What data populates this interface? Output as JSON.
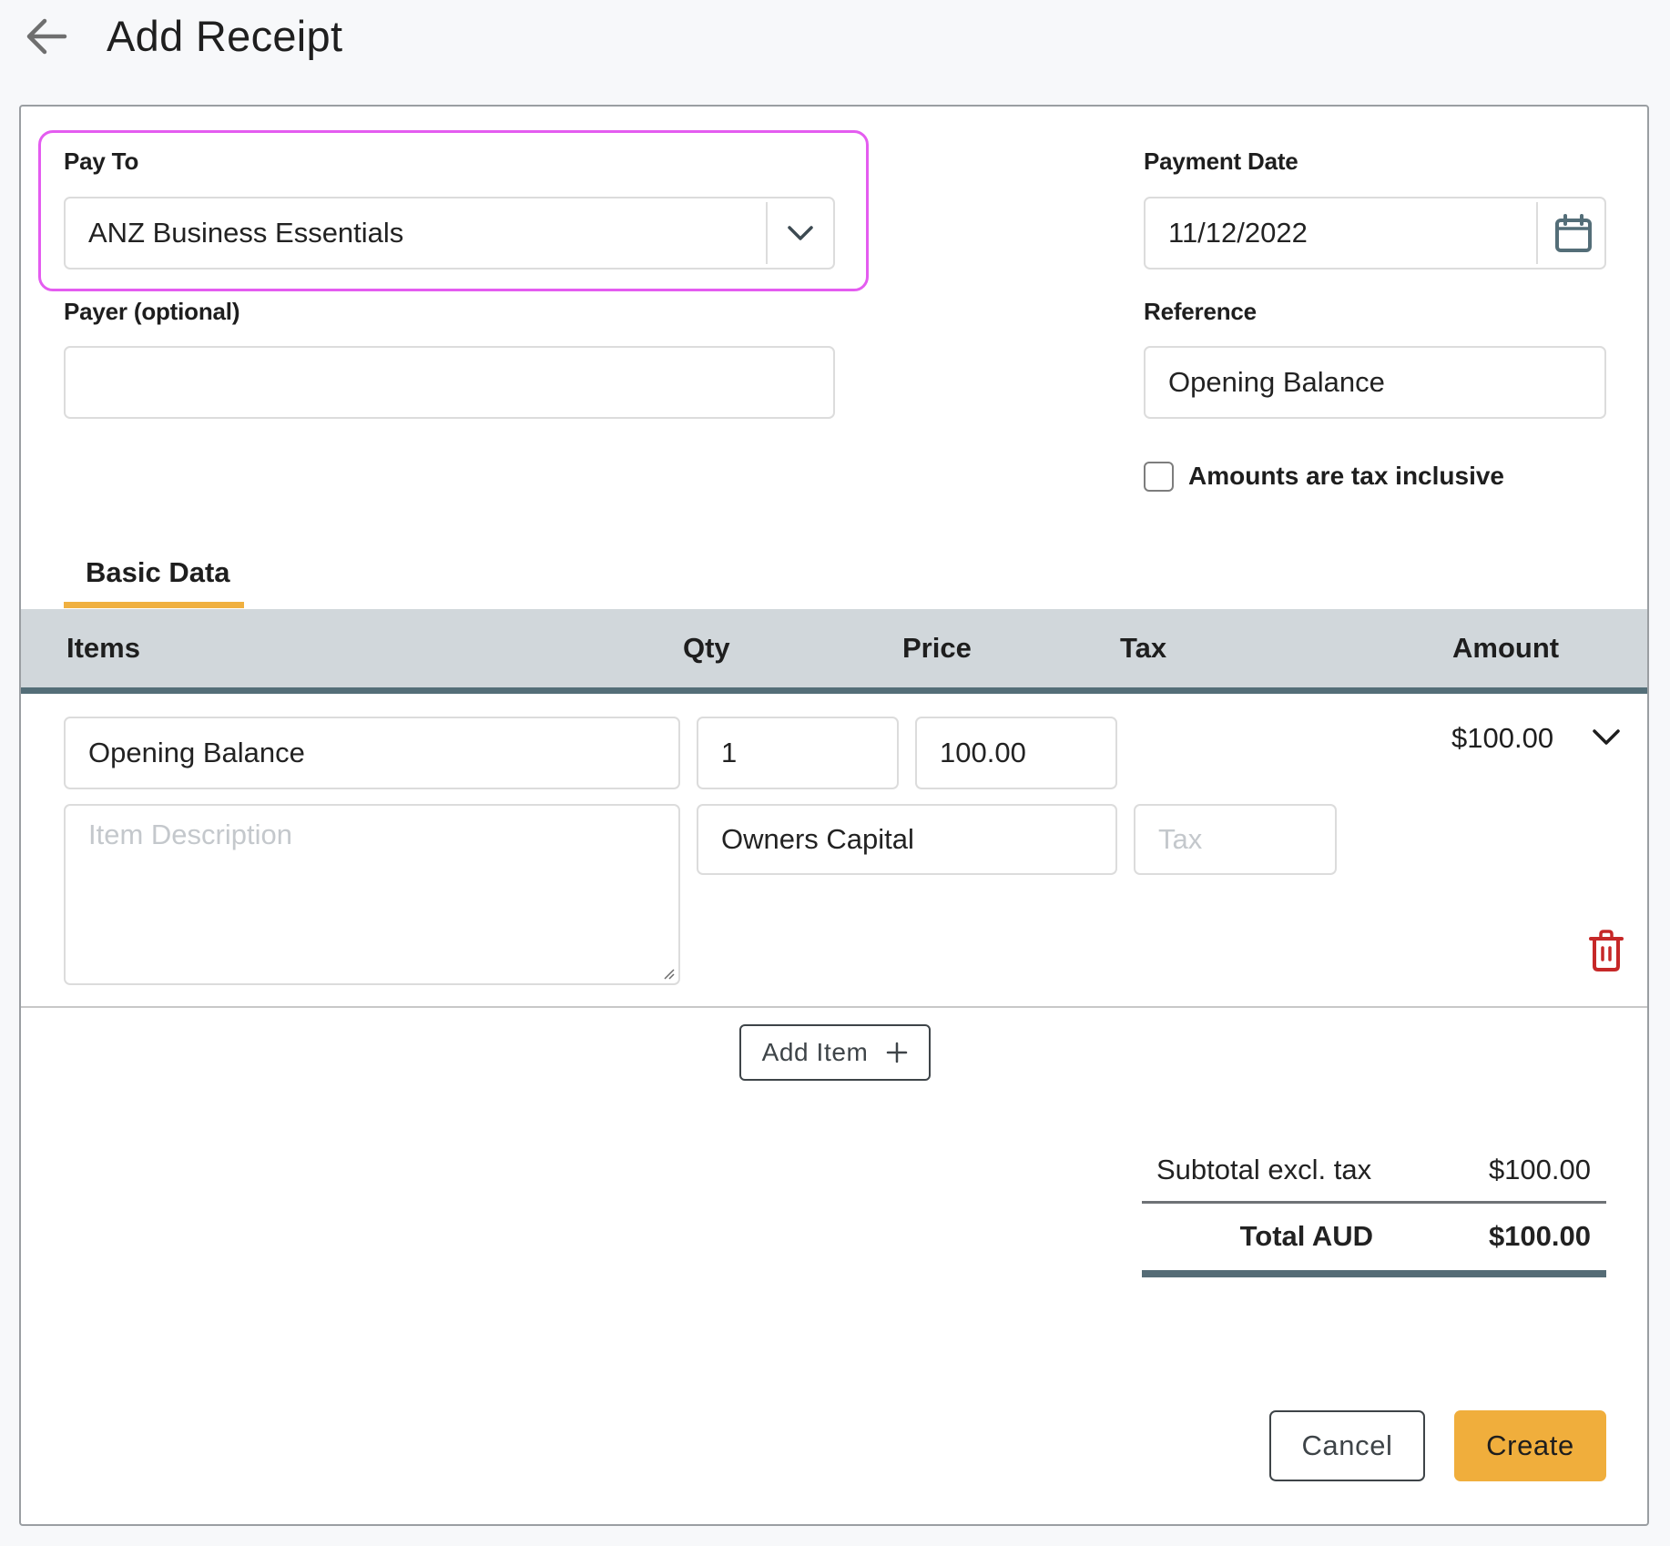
{
  "header": {
    "title": "Add Receipt",
    "back_icon": "arrow-left-icon"
  },
  "form": {
    "pay_to": {
      "label": "Pay To",
      "value": "ANZ Business Essentials",
      "icon": "chevron-down-icon"
    },
    "payer": {
      "label": "Payer (optional)",
      "value": ""
    },
    "payment_date": {
      "label": "Payment Date",
      "value": "11/12/2022",
      "icon": "calendar-icon"
    },
    "reference": {
      "label": "Reference",
      "value": "Opening Balance"
    },
    "tax_inclusive": {
      "label": "Amounts are tax inclusive",
      "checked": false
    }
  },
  "tabs": [
    {
      "label": "Basic Data",
      "active": true
    }
  ],
  "table": {
    "columns": [
      "Items",
      "Qty",
      "Price",
      "Tax",
      "Amount"
    ],
    "rows": [
      {
        "item": "Opening Balance",
        "qty": "1",
        "price": "100.00",
        "amount": "$100.00",
        "description_placeholder": "Item Description",
        "description": "",
        "account": "Owners Capital",
        "tax_placeholder": "Tax",
        "tax": "",
        "expand_icon": "chevron-down-icon",
        "delete_icon": "trash-icon"
      }
    ]
  },
  "add_item": {
    "label": "Add Item",
    "icon": "plus-icon"
  },
  "summary": {
    "subtotal_label": "Subtotal excl. tax",
    "subtotal_value": "$100.00",
    "total_label": "Total AUD",
    "total_value": "$100.00"
  },
  "actions": {
    "cancel_label": "Cancel",
    "create_label": "Create"
  },
  "colors": {
    "accent": "#f0ae3c",
    "highlight": "#e45cf0",
    "table_header_bg": "#d1d7db",
    "table_header_bar": "#546e78",
    "delete": "#c62828"
  }
}
